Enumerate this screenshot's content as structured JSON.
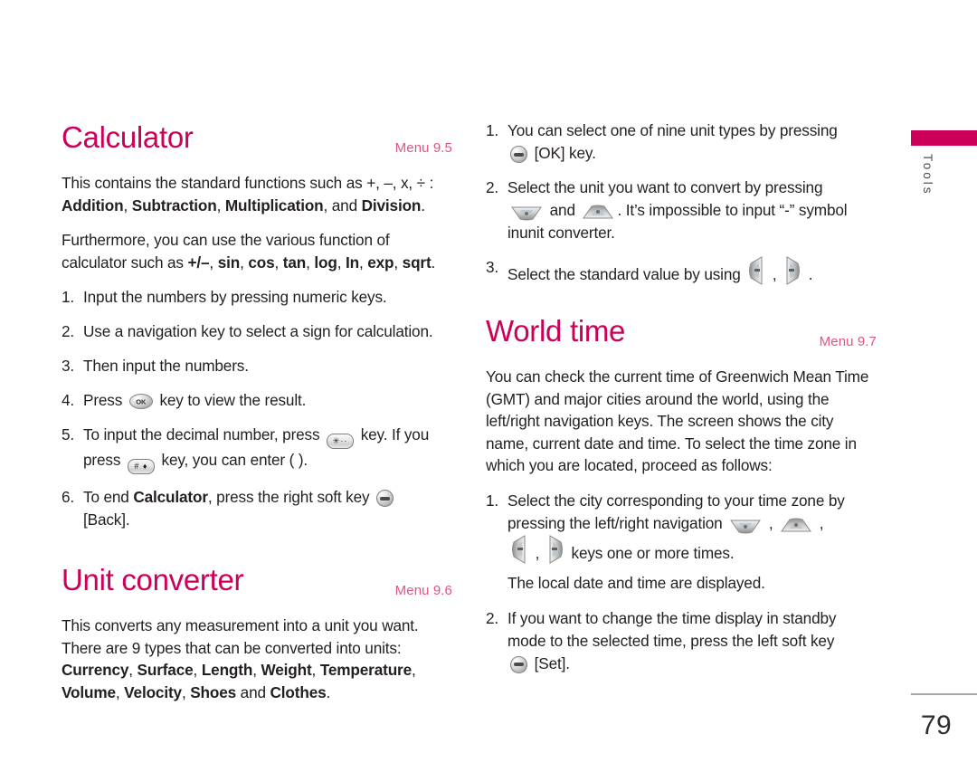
{
  "page": {
    "number": "79",
    "side_tab_label": "Tools",
    "accent_color": "#cc0058",
    "menu_tag_color": "#e0557f"
  },
  "left_column": {
    "sections": [
      {
        "title": "Calculator",
        "menu_tag": "Menu 9.5",
        "paragraphs": [
          {
            "lead": "This contains the standard functions such as +, –, x, ÷ : ",
            "bold_1": "Addition",
            "sep_1": ", ",
            "bold_2": "Subtraction",
            "sep_2": ", ",
            "bold_3": "Multiplication",
            "sep_3": ", and ",
            "bold_4": "Division",
            "tail": "."
          },
          {
            "lead": "Furthermore, you can use the various function of calculator such as ",
            "bold_1": "+/–",
            "sep_1": ", ",
            "bold_2": "sin",
            "sep_2": ", ",
            "bold_3": "cos",
            "sep_3": ", ",
            "bold_4": "tan",
            "sep_4": ", ",
            "bold_5": "log",
            "sep_5": ", ",
            "bold_6": "In",
            "sep_6": ", ",
            "bold_7": "exp",
            "sep_7": ", ",
            "bold_8": "sqrt",
            "tail": "."
          }
        ],
        "steps": [
          {
            "num": "1.",
            "text": "Input the numbers by pressing numeric keys."
          },
          {
            "num": "2.",
            "text": "Use a navigation key to select a sign for calculation."
          },
          {
            "num": "3.",
            "text": "Then input the numbers."
          },
          {
            "num": "4.",
            "pre": "Press ",
            "icon": "ok-key",
            "post": " key to view the result."
          },
          {
            "num": "5.",
            "pre": "To input the decimal number, press ",
            "icon": "star-key",
            "icon_label": "✳··",
            "mid": " key. If you press ",
            "icon2": "hash-key",
            "icon2_label": "# ♦",
            "post": " key, you can enter (  )."
          },
          {
            "num": "6.",
            "pre": "To end ",
            "bold": "Calculator",
            "mid": ", press the right soft key ",
            "icon": "soft-key",
            "post": "[Back]."
          }
        ]
      },
      {
        "title": "Unit converter",
        "menu_tag": "Menu 9.6",
        "paragraphs": [
          {
            "lead": "This converts any measurement into a unit you want. There are 9 types that can be converted into units: ",
            "bold_1": "Currency",
            "sep_1": ", ",
            "bold_2": "Surface",
            "sep_2": ", ",
            "bold_3": "Length",
            "sep_3": ", ",
            "bold_4": "Weight",
            "sep_4": ", ",
            "bold_5": "Temperature",
            "sep_5": ", ",
            "bold_6": "Volume",
            "sep_6": ", ",
            "bold_7": "Velocity",
            "sep_7": ", ",
            "bold_8": "Shoes",
            "sep_8": " and ",
            "bold_9": "Clothes",
            "tail": "."
          }
        ]
      }
    ]
  },
  "right_column": {
    "top_steps": [
      {
        "num": "1.",
        "pre": "You can select one of nine unit types by pressing ",
        "icon": "soft-key",
        "post": "[OK] key."
      },
      {
        "num": "2.",
        "pre": "Select the unit you want to convert by pressing ",
        "icon": "nav-down-key",
        "mid": " and ",
        "icon2": "nav-up-key",
        "post": ". It’s impossible to input  “-” symbol inunit converter."
      },
      {
        "num": "3.",
        "pre": "Select the standard value by using ",
        "icon": "nav-left-key",
        "mid": " , ",
        "icon2": "nav-right-key",
        "post": " ."
      }
    ],
    "sections": [
      {
        "title": "World time",
        "menu_tag": "Menu 9.7",
        "paragraph": "You can check the current time of Greenwich Mean Time (GMT) and major cities around the world, using the left/right navigation keys. The screen shows the city name, current date and time. To select the time zone in which you are located, proceed as follows:",
        "steps": [
          {
            "num": "1.",
            "pre": "Select the city corresponding to your time zone by pressing the left/right navigation ",
            "icon": "nav-down-key",
            "sep1": " , ",
            "icon2": "nav-up-key",
            "sep2": " ,",
            "icon3": "nav-left-key",
            "sep3": " , ",
            "icon4": "nav-right-key",
            "mid": " keys one or more times.",
            "subline": "The local date and time are displayed."
          },
          {
            "num": "2.",
            "pre": "If you want to change the time display in standby mode to the selected time, press the left soft key ",
            "icon": "soft-key",
            "post": "[Set]."
          }
        ]
      }
    ]
  }
}
